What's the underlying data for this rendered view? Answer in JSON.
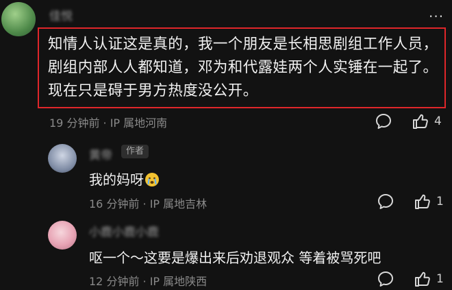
{
  "comments": [
    {
      "username": "佳悦",
      "text": "知情人认证这是真的，我一个朋友是长相思剧组工作人员，剧组内部人人都知道，邓为和代露娃两个人实锤在一起了。现在只是碍于男方热度没公开。",
      "meta": "19 分钟前 · IP 属地河南",
      "like_count": "4"
    }
  ],
  "replies": [
    {
      "username": "黄帝",
      "badge": "作者",
      "text": "我的妈呀",
      "meta": "16 分钟前 · IP 属地吉林",
      "like_count": "1"
    },
    {
      "username": "小鹿小鹿小鹿",
      "text": "呕一个～这要是爆出来后劝退观众  等着被骂死吧",
      "meta": "12 分钟前 · IP 属地陕西",
      "like_count": "1"
    }
  ],
  "icons": {
    "more": "more-icon",
    "reply": "comment-bubble-icon",
    "like": "thumbs-up-icon",
    "emoji": "crying-face-emoji"
  },
  "colors": {
    "background": "#121212",
    "highlight": "#e0262a",
    "meta": "#8a8a8a",
    "badge_bg": "#2e2e2e"
  }
}
